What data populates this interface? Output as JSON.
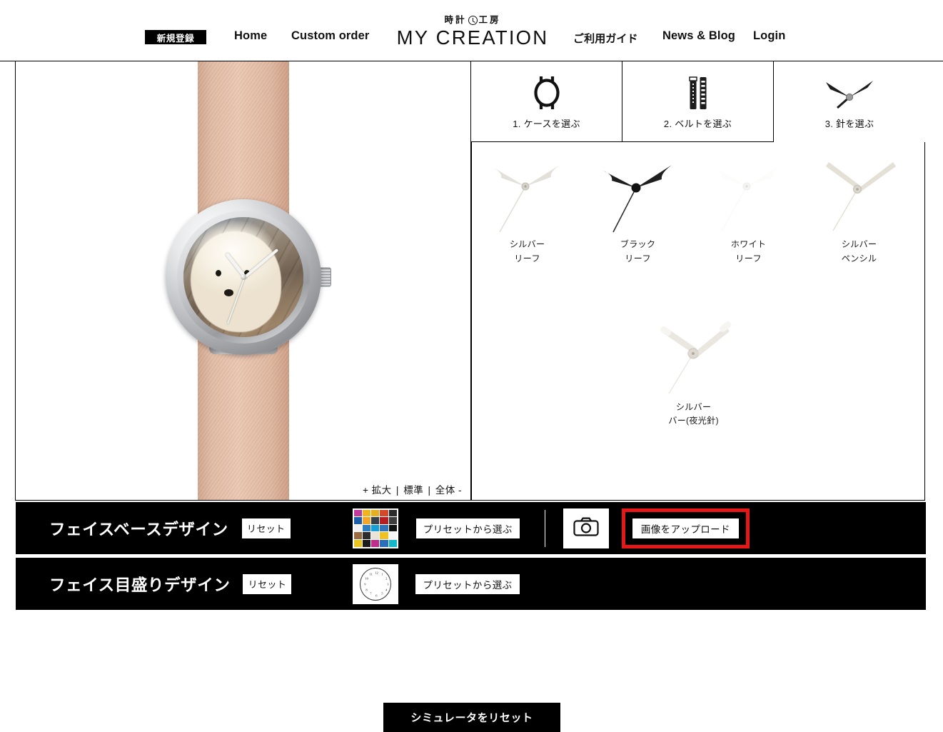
{
  "header": {
    "signup_label": "新規登録",
    "nav": [
      {
        "id": "home",
        "label": "Home"
      },
      {
        "id": "custom-order",
        "label": "Custom order"
      },
      {
        "id": "guide",
        "label": "ご利用ガイド"
      },
      {
        "id": "news",
        "label": "News & Blog"
      },
      {
        "id": "login",
        "label": "Login"
      }
    ],
    "brand_kicker": "時計",
    "brand_kicker_suffix": "工房",
    "brand_name": "MY CREATION",
    "brand_clock_icon": "clock-icon"
  },
  "preview": {
    "zoom": {
      "enlarge": "+ 拡大",
      "standard": "標準",
      "whole": "全体 -",
      "separator": "|"
    },
    "watch": {
      "case_color": "#c9cbcd",
      "strap_color": "#e3bca6",
      "dial_image": "dog-photo",
      "hands_style": "シルバーリーフ"
    }
  },
  "options": {
    "steps": [
      {
        "id": "case",
        "label": "1. ケースを選ぶ",
        "icon": "watch-case-icon",
        "active": false
      },
      {
        "id": "belt",
        "label": "2. ベルトを選ぶ",
        "icon": "watch-belt-icon",
        "active": false
      },
      {
        "id": "hands",
        "label": "3. 針を選ぶ",
        "icon": "watch-hands-icon",
        "active": true
      }
    ],
    "hands": [
      {
        "id": "silver-leaf",
        "line1": "シルバー",
        "line2": "リーフ",
        "color": "#e9e7e2",
        "style": "leaf"
      },
      {
        "id": "black-leaf",
        "line1": "ブラック",
        "line2": "リーフ",
        "color": "#1d1d1d",
        "style": "leaf"
      },
      {
        "id": "white-leaf",
        "line1": "ホワイト",
        "line2": "リーフ",
        "color": "#fbfbfb",
        "style": "leaf"
      },
      {
        "id": "silver-pencil",
        "line1": "シルバー",
        "line2": "ペンシル",
        "color": "#e6e2d9",
        "style": "pencil"
      },
      {
        "id": "silver-bar-lume",
        "line1": "シルバー",
        "line2": "バー(夜光針)",
        "color": "#eeece6",
        "style": "bar"
      }
    ]
  },
  "design_rows": [
    {
      "id": "face-base",
      "title": "フェイスベースデザイン",
      "reset_label": "リセット",
      "preset_label": "プリセットから選ぶ",
      "thumb": "preset-mosaic-thumbnail",
      "camera_icon": "camera-icon",
      "upload_label": "画像をアップロード",
      "upload_highlight_color": "#e81717"
    },
    {
      "id": "face-scale",
      "title": "フェイス目盛りデザイン",
      "reset_label": "リセット",
      "preset_label": "プリセットから選ぶ",
      "thumb": "clock-face-thumbnail"
    }
  ],
  "footer": {
    "reset_simulator_label": "シミュレータをリセット"
  },
  "clock_thumb_numerals": [
    "12",
    "1",
    "2",
    "3",
    "4",
    "5",
    "6",
    "7",
    "8",
    "9",
    "10",
    "11"
  ]
}
